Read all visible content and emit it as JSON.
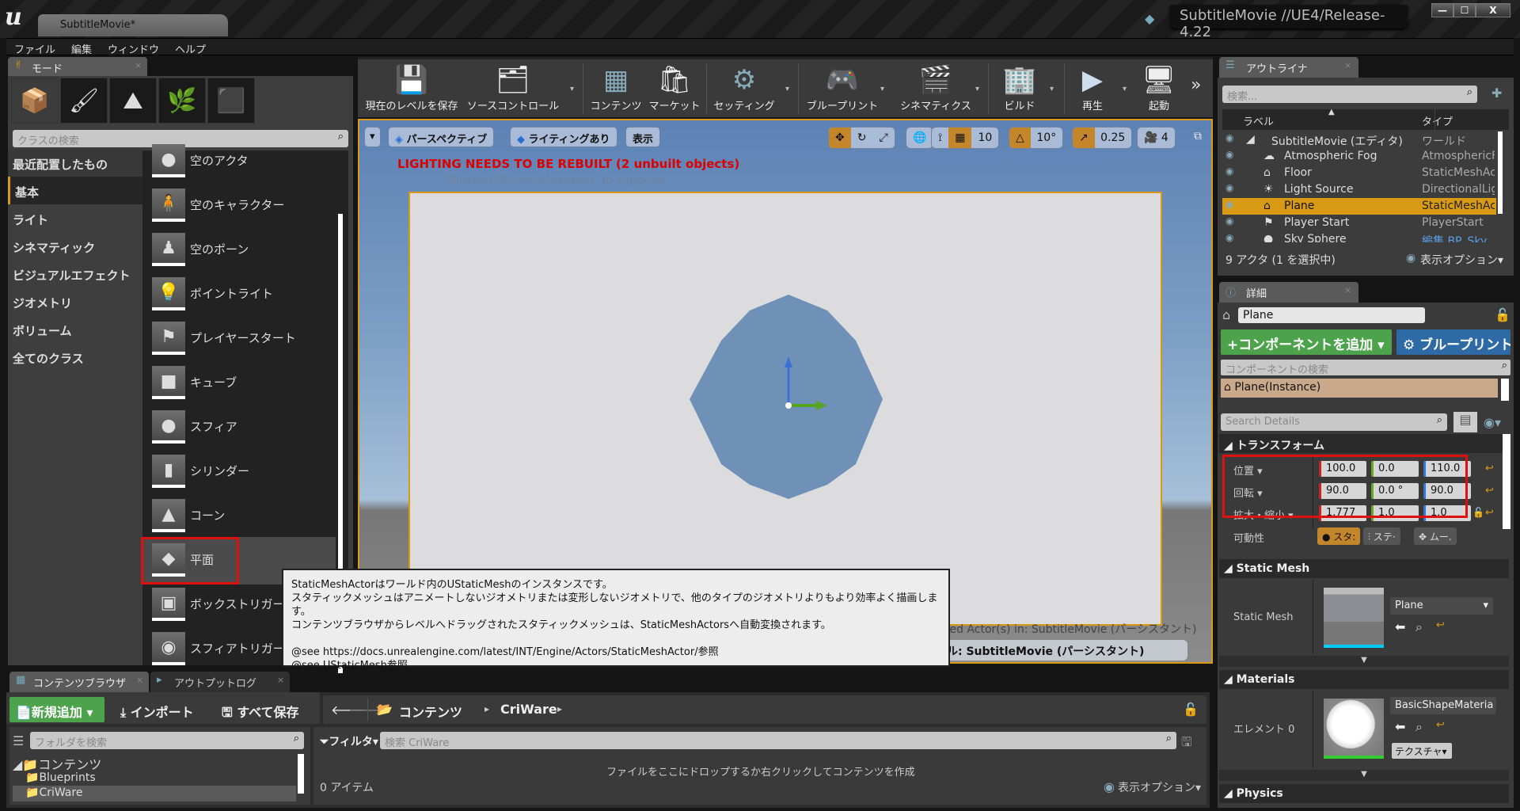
{
  "window": {
    "doc_tab": "SubtitleMovie*",
    "project_label": "SubtitleMovie //UE4/Release-4.22",
    "controls": {
      "minimize": "—",
      "maximize": "☐",
      "close": "X"
    }
  },
  "menu": [
    "ファイル",
    "編集",
    "ウィンドウ",
    "ヘルプ"
  ],
  "modes": {
    "tab_label": "モード",
    "tab_close": "×",
    "mode_buttons": [
      {
        "name": "place",
        "glyph": "📦"
      },
      {
        "name": "paint",
        "glyph": "🖌"
      },
      {
        "name": "landscape",
        "glyph": "⛰"
      },
      {
        "name": "foliage",
        "glyph": "🌿"
      },
      {
        "name": "geometry",
        "glyph": "⬛"
      }
    ],
    "search_placeholder": "クラスの検索",
    "categories": [
      "最近配置したもの",
      "基本",
      "ライト",
      "シネマティック",
      "ビジュアルエフェクト",
      "ジオメトリ",
      "ボリューム",
      "全てのクラス"
    ],
    "active_category": "基本",
    "items": [
      {
        "label": "空のアクタ",
        "glyph": "●"
      },
      {
        "label": "空のキャラクター",
        "glyph": "🧍"
      },
      {
        "label": "空のポーン",
        "glyph": "♟"
      },
      {
        "label": "ポイントライト",
        "glyph": "💡"
      },
      {
        "label": "プレイヤースタート",
        "glyph": "⚑"
      },
      {
        "label": "キューブ",
        "glyph": "■"
      },
      {
        "label": "スフィア",
        "glyph": "●"
      },
      {
        "label": "シリンダー",
        "glyph": "▮"
      },
      {
        "label": "コーン",
        "glyph": "▲"
      },
      {
        "label": "平面",
        "glyph": "◆"
      },
      {
        "label": "ボックストリガー",
        "glyph": "▣"
      },
      {
        "label": "スフィアトリガー",
        "glyph": "◉"
      }
    ],
    "selected_item": "平面"
  },
  "toolbar": {
    "buttons": [
      {
        "label": "現在のレベルを保存",
        "glyph": "💾"
      },
      {
        "label": "ソースコントロール",
        "glyph": "🗂"
      },
      {
        "label": "コンテンツ",
        "glyph": "▦"
      },
      {
        "label": "マーケット",
        "glyph": "🛍"
      },
      {
        "label": "セッティング",
        "glyph": "⚙"
      },
      {
        "label": "ブループリント",
        "glyph": "🎮"
      },
      {
        "label": "シネマティクス",
        "glyph": "🎬"
      },
      {
        "label": "ビルド",
        "glyph": "🏢"
      },
      {
        "label": "再生",
        "glyph": "▶"
      },
      {
        "label": "起動",
        "glyph": "🖥"
      }
    ],
    "overflow": "»",
    "dropdown": "▾"
  },
  "viewport": {
    "menu_arrow": "▾",
    "perspective": "パースペクティブ",
    "lighting": "ライティングあり",
    "show": "表示",
    "lighting_warning": "LIGHTING NEEDS TO BE REBUILT (2 unbuilt objects)",
    "suppress_hint": "'DisableAllScreenMessages' to suppress",
    "grid_snap": "10",
    "rotation_snap": "10°",
    "scale_snap": "0.25",
    "camera_speed": "4",
    "status_selected": "ted Actor(s) in:  SubtitleMovie (パーシスタント)",
    "status_level": "ル: SubtitleMovie (パーシスタント)"
  },
  "tooltip": {
    "lines": [
      "StaticMeshActorはワールド内のUStaticMeshのインスタンスです。",
      "スタティックメッシュはアニメートしないジオメトリまたは変形しないジオメトリで、他のタイプのジオメトリよりもより効率よく描画します。",
      "コンテンツブラウザからレベルへドラッグされたスタティックメッシュは、StaticMeshActorsへ自動変換されます。",
      "",
      "@see https://docs.unrealengine.com/latest/INT/Engine/Actors/StaticMeshActor/参照",
      "@see UStaticMesh参照"
    ]
  },
  "outliner": {
    "tab_label": "アウトライナ",
    "tab_close": "×",
    "search_placeholder": "検索...",
    "col_label": "ラベル",
    "col_type": "タイプ",
    "rows": [
      {
        "label": "SubtitleMovie (エディタ)",
        "type": "ワールド",
        "indent": 0,
        "glyph": "◢"
      },
      {
        "label": "Atmospheric Fog",
        "type": "AtmosphericFog",
        "indent": 1,
        "glyph": "☁"
      },
      {
        "label": "Floor",
        "type": "StaticMeshActor",
        "indent": 1,
        "glyph": "⌂"
      },
      {
        "label": "Light Source",
        "type": "DirectionalLight",
        "indent": 1,
        "glyph": "☀"
      },
      {
        "label": "Plane",
        "type": "StaticMeshActor",
        "indent": 1,
        "glyph": "⌂",
        "selected": true
      },
      {
        "label": "Player Start",
        "type": "PlayerStart",
        "indent": 1,
        "glyph": "⚑"
      },
      {
        "label": "Sky Sphere",
        "type": "編集 BP_Sky",
        "indent": 1,
        "glyph": "●"
      }
    ],
    "footer_count": "9 アクタ (1 を選択中)",
    "view_options": "表示オプション▾"
  },
  "details": {
    "tab_label": "詳細",
    "tab_close": "×",
    "actor_name": "Plane",
    "add_component": "+コンポーネントを追加 ▾",
    "blueprint": "⚙ ブループリント",
    "component_search_placeholder": "コンポーネントの検索",
    "component_root": "Plane(Instance)",
    "search_placeholder": "Search Details",
    "transform": {
      "section": "トランスフォーム",
      "location_label": "位置 ▾",
      "rotation_label": "回転 ▾",
      "scale_label": "拡大・縮小 ▾",
      "location": [
        "100.0",
        "0.0",
        "110.0"
      ],
      "rotation": [
        "90.0",
        "0.0 °",
        "90.0"
      ],
      "scale": [
        "1.777",
        "1.0",
        "1.0"
      ],
      "mobility_label": "可動性",
      "mobility_options": [
        "スタ:",
        "ステ·",
        "ムー."
      ]
    },
    "static_mesh": {
      "section": "Static Mesh",
      "label": "Static Mesh",
      "value": "Plane"
    },
    "materials": {
      "section": "Materials",
      "label": "エレメント 0",
      "value": "BasicShapeMateria",
      "texture_btn": "テクスチャ▾"
    },
    "physics_section": "Physics"
  },
  "content_browser": {
    "tab_label": "コンテンツブラウザ",
    "output_tab_label": "アウトプットログ",
    "tab_close": "×",
    "new_btn": "新規追加 ▾",
    "import_btn": "インポート",
    "save_all_btn": "すべて保存",
    "breadcrumb": [
      "コンテンツ",
      "CriWare"
    ],
    "folder_search_placeholder": "フォルダを検索",
    "folders": [
      {
        "label": "コンテンツ",
        "root": true
      },
      {
        "label": "Blueprints"
      },
      {
        "label": "CriWare",
        "selected": true
      }
    ],
    "filter": "フィルタ▾",
    "asset_search_placeholder": "検索 CriWare",
    "empty_hint": "ファイルをここにドロップするか右クリックしてコンテンツを作成",
    "item_count": "0 アイテム",
    "view_options": "表示オプション▾"
  }
}
